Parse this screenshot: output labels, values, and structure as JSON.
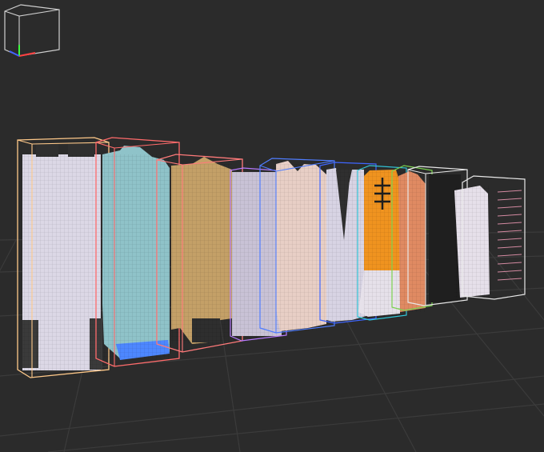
{
  "viewport": {
    "background": "#2b2b2b",
    "grid_color": "#3b3b3b",
    "voxel_models": [
      {
        "name": "voxel-model-1",
        "fill": "#dcd8e6",
        "box_color": "#ffc98a"
      },
      {
        "name": "voxel-model-2",
        "fill": "#8fc3c9",
        "box_color": "#ff6b6b"
      },
      {
        "name": "voxel-model-3",
        "fill": "#c4a067",
        "box_color": "#ff7a7a"
      },
      {
        "name": "voxel-model-4",
        "fill": "#c9c2d6",
        "box_color": "#b77bff"
      },
      {
        "name": "voxel-model-5",
        "fill": "#e8cfc6",
        "box_color": "#4f7dff"
      },
      {
        "name": "voxel-model-6",
        "fill": "#d8d4e4",
        "box_color": "#3f66ff"
      },
      {
        "name": "voxel-model-7",
        "fill": "#f0931f",
        "box_color": "#32c6d8"
      },
      {
        "name": "voxel-model-8",
        "fill": "#e08a62",
        "box_color": "#7bd34f"
      },
      {
        "name": "voxel-model-9",
        "fill": "#1f1f1f",
        "box_color": "#e8e8e8"
      },
      {
        "name": "voxel-model-10",
        "fill": "#e6e0ea",
        "box_color": "#e8e8e8"
      }
    ],
    "axes": {
      "x_color": "#ff4040",
      "y_color": "#3cff3c",
      "z_color": "#4060ff"
    }
  }
}
